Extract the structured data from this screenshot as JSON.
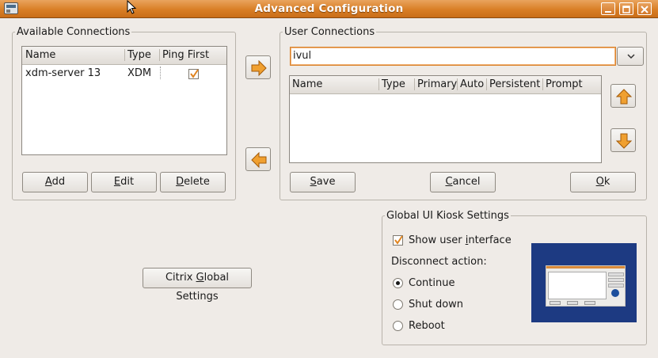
{
  "window": {
    "title": "Advanced Configuration"
  },
  "available": {
    "legend": "Available Connections",
    "columns": [
      "Name",
      "Type",
      "Ping First"
    ],
    "rows": [
      {
        "name": "xdm-server 13",
        "type": "XDM",
        "ping_first": true
      }
    ],
    "buttons": {
      "add_u": "A",
      "add_rest": "dd",
      "edit_u": "E",
      "edit_rest": "dit",
      "delete_u": "D",
      "delete_rest": "elete"
    }
  },
  "user": {
    "legend": "User Connections",
    "combo_value": "ivul",
    "columns": [
      "Name",
      "Type",
      "Primary",
      "Auto",
      "Persistent",
      "Prompt"
    ],
    "rows": [],
    "buttons": {
      "save_u": "S",
      "save_rest": "ave",
      "cancel_u": "C",
      "cancel_rest": "ancel",
      "ok_u": "O",
      "ok_rest": "k"
    }
  },
  "citrix": {
    "pre": "Citrix ",
    "u": "G",
    "rest": "lobal Settings"
  },
  "kiosk": {
    "legend": "Global UI Kiosk Settings",
    "show_ui": {
      "pre": "Show user ",
      "u": "i",
      "rest": "nterface",
      "checked": true
    },
    "disconnect_label": "Disconnect action:",
    "options": [
      {
        "label": "Continue",
        "selected": true
      },
      {
        "label": "Shut down",
        "selected": false
      },
      {
        "label": "Reboot",
        "selected": false
      }
    ]
  },
  "colors": {
    "titlebar": "#d97f26",
    "arrow": "#f0a030",
    "preview_bg": "#1d3a82"
  },
  "icons": [
    "app-icon",
    "minimize-icon",
    "maximize-icon",
    "close-icon",
    "arrow-right-icon",
    "arrow-left-icon",
    "arrow-up-icon",
    "arrow-down-icon",
    "dropdown-icon",
    "checkmark-icon"
  ]
}
